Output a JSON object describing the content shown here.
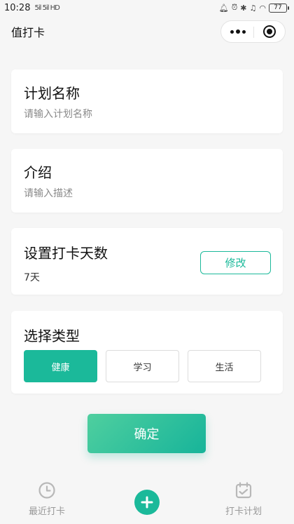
{
  "status_bar": {
    "time": "10:28",
    "signal_text": "5il 5il HD",
    "battery": "77"
  },
  "nav": {
    "title": "值打卡"
  },
  "plan_name": {
    "title": "计划名称",
    "placeholder": "请输入计划名称",
    "value": ""
  },
  "intro": {
    "title": "介绍",
    "placeholder": "请输入描述",
    "value": ""
  },
  "days": {
    "title": "设置打卡天数",
    "value": "7天",
    "modify_label": "修改"
  },
  "type": {
    "title": "选择类型",
    "options": [
      "健康",
      "学习",
      "生活"
    ],
    "selected": "健康"
  },
  "confirm_label": "确定",
  "tabs": {
    "recent_label": "最近打卡",
    "plan_label": "打卡计划"
  },
  "colors": {
    "accent": "#1bb99a",
    "background": "#f6f6f6",
    "tab_inactive": "#999999"
  }
}
